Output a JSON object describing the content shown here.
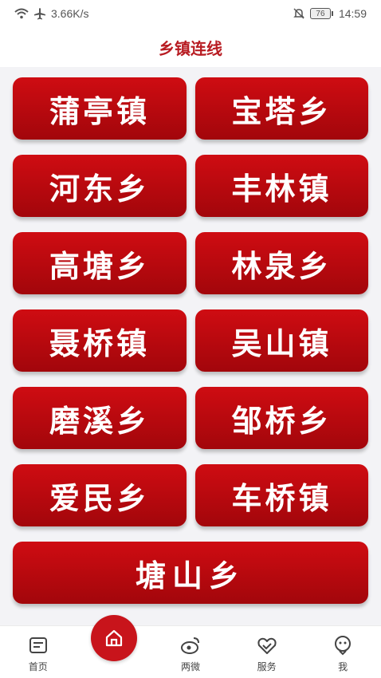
{
  "status": {
    "speed": "3.66K/s",
    "battery": "76",
    "time": "14:59"
  },
  "header": {
    "title": "乡镇连线"
  },
  "towns": [
    "蒲亭镇",
    "宝塔乡",
    "河东乡",
    "丰林镇",
    "高塘乡",
    "林泉乡",
    "聂桥镇",
    "吴山镇",
    "磨溪乡",
    "邹桥乡",
    "爱民乡",
    "车桥镇",
    "塘山乡"
  ],
  "tabbar": {
    "home": "首页",
    "center": "",
    "weibo": "两微",
    "service": "服务",
    "me": "我"
  },
  "colors": {
    "accent": "#c8141b",
    "tile": "#b0070d",
    "title": "#b81c22"
  }
}
